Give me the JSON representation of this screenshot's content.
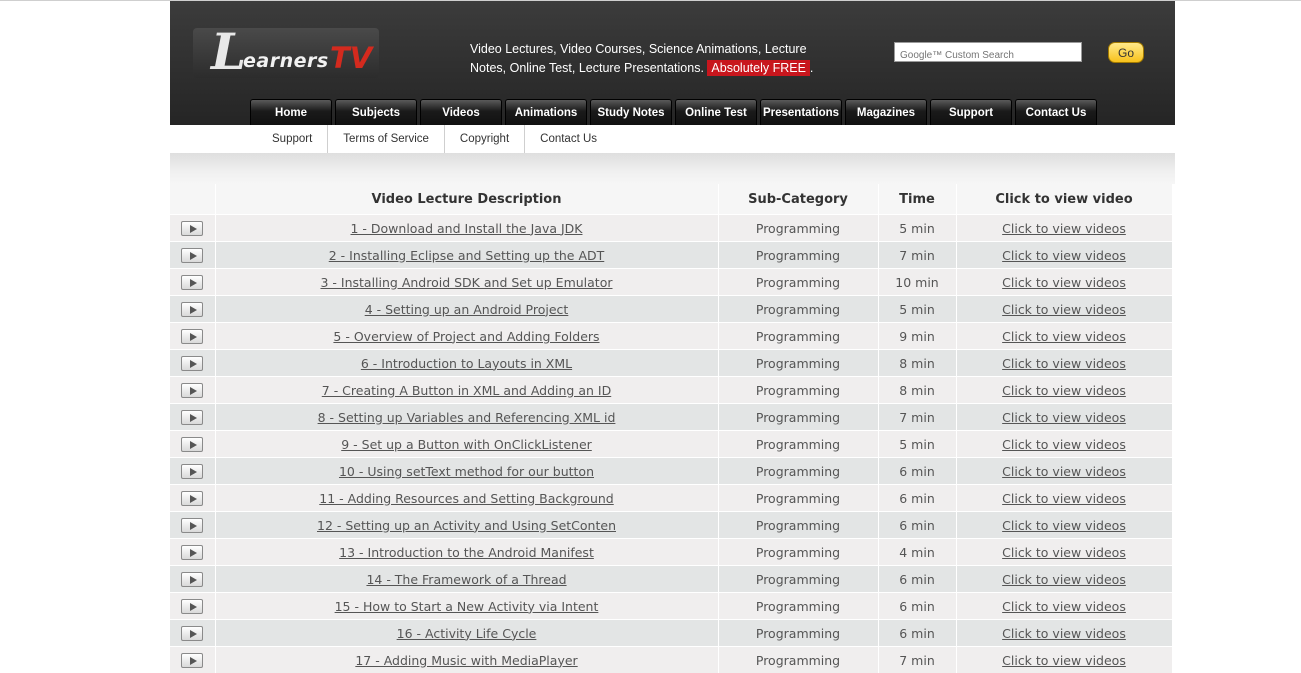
{
  "header": {
    "logo_initial": "L",
    "logo_text": "earners",
    "logo_accent": "TV",
    "tagline": "Video Lectures, Video Courses, Science Animations, Lecture Notes, Online Test, Lecture Presentations.",
    "tagline_highlight": "Absolutely FREE",
    "tagline_end": ".",
    "search_placeholder": "Google™ Custom Search",
    "go_label": "Go"
  },
  "nav": [
    "Home",
    "Subjects",
    "Videos",
    "Animations",
    "Study Notes",
    "Online Test",
    "Presentations",
    "Magazines",
    "Support",
    "Contact Us"
  ],
  "subnav": [
    "Support",
    "Terms of Service",
    "Copyright",
    "Contact Us"
  ],
  "table": {
    "headers": [
      "",
      "Video Lecture Description",
      "Sub-Category",
      "Time",
      "Click to view video"
    ],
    "rows": [
      {
        "title": "1 - Download and Install the Java JDK",
        "category": "Programming",
        "time": "5 min",
        "link": "Click to view videos"
      },
      {
        "title": "2 - Installing Eclipse and Setting up the ADT",
        "category": "Programming",
        "time": "7 min",
        "link": "Click to view videos"
      },
      {
        "title": "3 - Installing Android SDK and Set up Emulator",
        "category": "Programming",
        "time": "10 min",
        "link": "Click to view videos"
      },
      {
        "title": "4 - Setting up an Android Project",
        "category": "Programming",
        "time": "5 min",
        "link": "Click to view videos"
      },
      {
        "title": "5 - Overview of Project and Adding Folders",
        "category": "Programming",
        "time": "9 min",
        "link": "Click to view videos"
      },
      {
        "title": "6 - Introduction to Layouts in XML",
        "category": "Programming",
        "time": "8 min",
        "link": "Click to view videos"
      },
      {
        "title": "7 - Creating A Button in XML and Adding an ID",
        "category": "Programming",
        "time": "8 min",
        "link": "Click to view videos"
      },
      {
        "title": "8 - Setting up Variables and Referencing XML id",
        "category": "Programming",
        "time": "7 min",
        "link": "Click to view videos"
      },
      {
        "title": "9 - Set up a Button with OnClickListener",
        "category": "Programming",
        "time": "5 min",
        "link": "Click to view videos"
      },
      {
        "title": "10 - Using setText method for our button",
        "category": "Programming",
        "time": "6 min",
        "link": "Click to view videos"
      },
      {
        "title": "11 - Adding Resources and Setting Background",
        "category": "Programming",
        "time": "6 min",
        "link": "Click to view videos"
      },
      {
        "title": "12 - Setting up an Activity and Using SetConten",
        "category": "Programming",
        "time": "6 min",
        "link": "Click to view videos"
      },
      {
        "title": "13 - Introduction to the Android Manifest",
        "category": "Programming",
        "time": "4 min",
        "link": "Click to view videos"
      },
      {
        "title": "14 - The Framework of a Thread",
        "category": "Programming",
        "time": "6 min",
        "link": "Click to view videos"
      },
      {
        "title": "15 - How to Start a New Activity via Intent",
        "category": "Programming",
        "time": "6 min",
        "link": "Click to view videos"
      },
      {
        "title": "16 - Activity Life Cycle",
        "category": "Programming",
        "time": "6 min",
        "link": "Click to view videos"
      },
      {
        "title": "17 - Adding Music with MediaPlayer",
        "category": "Programming",
        "time": "7 min",
        "link": "Click to view videos"
      }
    ]
  },
  "colors": {
    "accent_red": "#c8161d",
    "header_dark": "#2e2e2e",
    "row_odd": "#f0eeee",
    "row_even": "#e3e5e5"
  }
}
